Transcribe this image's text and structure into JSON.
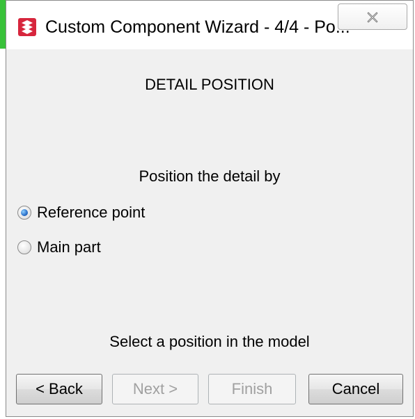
{
  "window": {
    "title": "Custom Component Wizard - 4/4 - Po...",
    "app_icon": "tekla-logo-icon",
    "close_icon": "close-x-icon"
  },
  "content": {
    "heading": "DETAIL POSITION",
    "prompt": "Position the detail by",
    "options": [
      {
        "label": "Reference point",
        "checked": true
      },
      {
        "label": "Main part",
        "checked": false
      }
    ],
    "status": "Select a position in the model"
  },
  "buttons": {
    "back": "< Back",
    "next": "Next >",
    "finish": "Finish",
    "cancel": "Cancel"
  },
  "colors": {
    "accent_green": "#39c13a",
    "dialog_bg": "#f0f0f0",
    "logo_red": "#d7263d"
  }
}
